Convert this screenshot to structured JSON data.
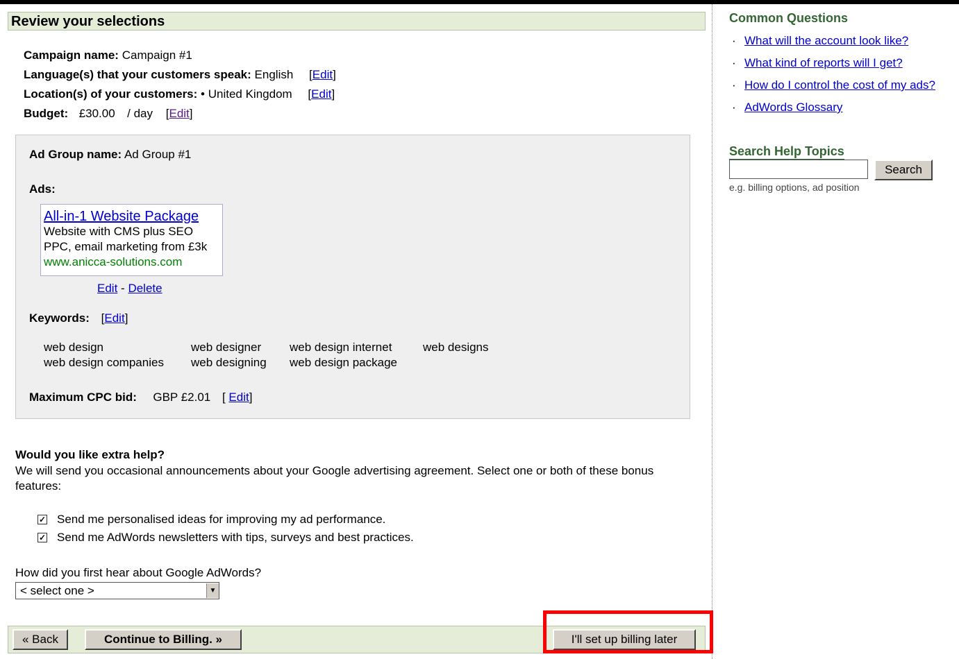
{
  "review": {
    "title": "Review your selections",
    "campaign_label": "Campaign name:",
    "campaign_value": "Campaign #1",
    "language_label": "Language(s) that your customers speak:",
    "language_value": "English",
    "location_label": "Location(s) of your customers:",
    "location_value": "• United Kingdom",
    "budget_label": "Budget:",
    "budget_value": "£30.00",
    "budget_unit": "/ day",
    "edit_label": "Edit"
  },
  "adgroup": {
    "name_label": "Ad Group name:",
    "name_value": "Ad Group #1",
    "ads_label": "Ads:",
    "ad": {
      "title": "All-in-1 Website Package",
      "line1": "Website with CMS plus SEO",
      "line2": "PPC, email marketing from £3k",
      "url": "www.anicca-solutions.com"
    },
    "ad_edit": "Edit",
    "ad_sep": "-",
    "ad_delete": "Delete",
    "keywords_label": "Keywords:",
    "keywords": [
      "web design",
      "web designer",
      "web design internet",
      "web designs",
      "web design companies",
      "web designing",
      "web design package"
    ],
    "cpc_label": "Maximum CPC bid:",
    "cpc_value": "GBP £2.01"
  },
  "extra_help": {
    "title": "Would you like extra help?",
    "text": "We will send you occasional announcements about your Google advertising agreement. Select one or both of these bonus features:",
    "options": [
      {
        "label": "Send me personalised ideas for improving my ad performance.",
        "checked": true
      },
      {
        "label": "Send me AdWords newsletters with tips, surveys and best practices.",
        "checked": true
      }
    ],
    "hear_label": "How did you first hear about Google AdWords?",
    "hear_selected": "< select one >"
  },
  "footer": {
    "back": "« Back",
    "continue": "Continue to Billing. »",
    "later": "I'll set up billing later",
    "highlight_color": "#ff0000"
  },
  "sidebar": {
    "questions_title": "Common Questions",
    "questions": [
      "What will the account look like?",
      "What kind of reports will I get?",
      "How do I control the cost of my ads?",
      "AdWords Glossary"
    ],
    "search_title": "Search Help Topics",
    "search_button": "Search",
    "search_hint": "e.g. billing options, ad position"
  },
  "colors": {
    "header_bg": "#e5ecd8",
    "sidebar_title": "#336633",
    "link": "#0000cc",
    "ad_url": "#008000"
  }
}
